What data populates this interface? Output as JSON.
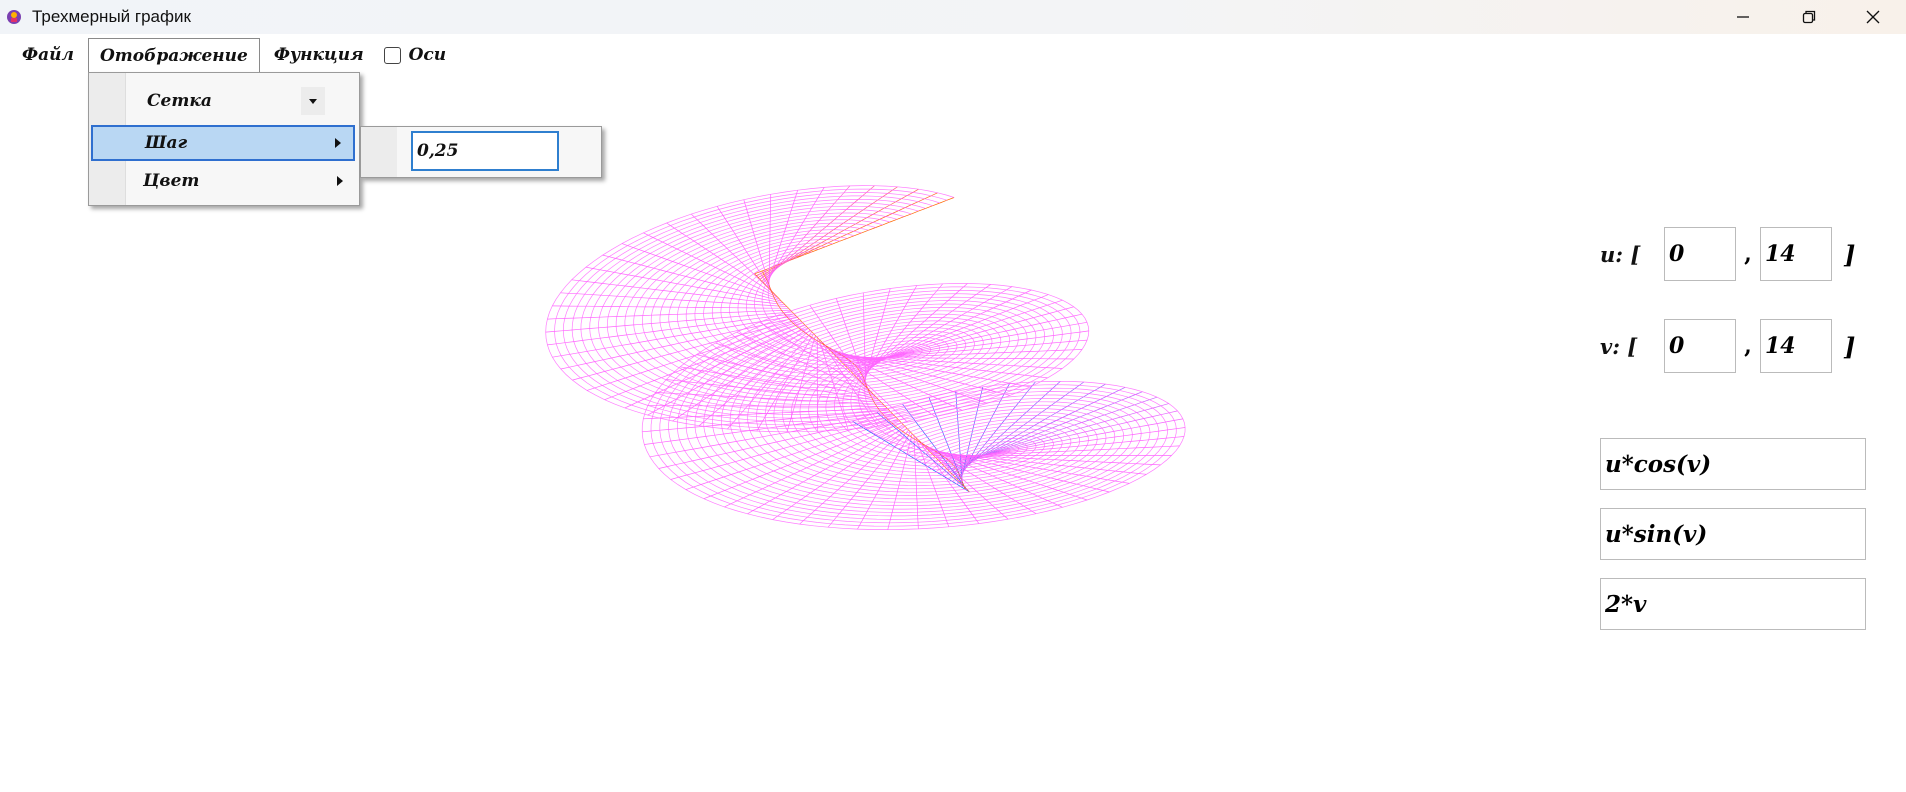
{
  "window": {
    "title": "Трехмерный график"
  },
  "menubar": {
    "file": "Файл",
    "display": "Отображение",
    "function": "Функция",
    "axes_label": "Оси",
    "axes_checked": false
  },
  "display_menu": {
    "items": [
      {
        "label": "Сетка",
        "kind": "combo"
      },
      {
        "label": "Шаг",
        "kind": "submenu",
        "highlighted": true
      },
      {
        "label": "Цвет",
        "kind": "submenu"
      }
    ],
    "step_value": "0,25"
  },
  "ranges": {
    "u": {
      "label": "u: [",
      "min": "0",
      "max": "14"
    },
    "v": {
      "label": "v: [",
      "min": "0",
      "max": "14"
    },
    "separator": ",",
    "close": "]"
  },
  "functions": {
    "x": "u*cos(v)",
    "y": "u*sin(v)",
    "z": "2*v"
  },
  "surface": {
    "main_color": "#ff66ff",
    "edge_color_start": "#ff6600",
    "edge_color_end": "#1a66ff",
    "u_range": [
      0,
      14
    ],
    "v_range": [
      0,
      14
    ]
  }
}
